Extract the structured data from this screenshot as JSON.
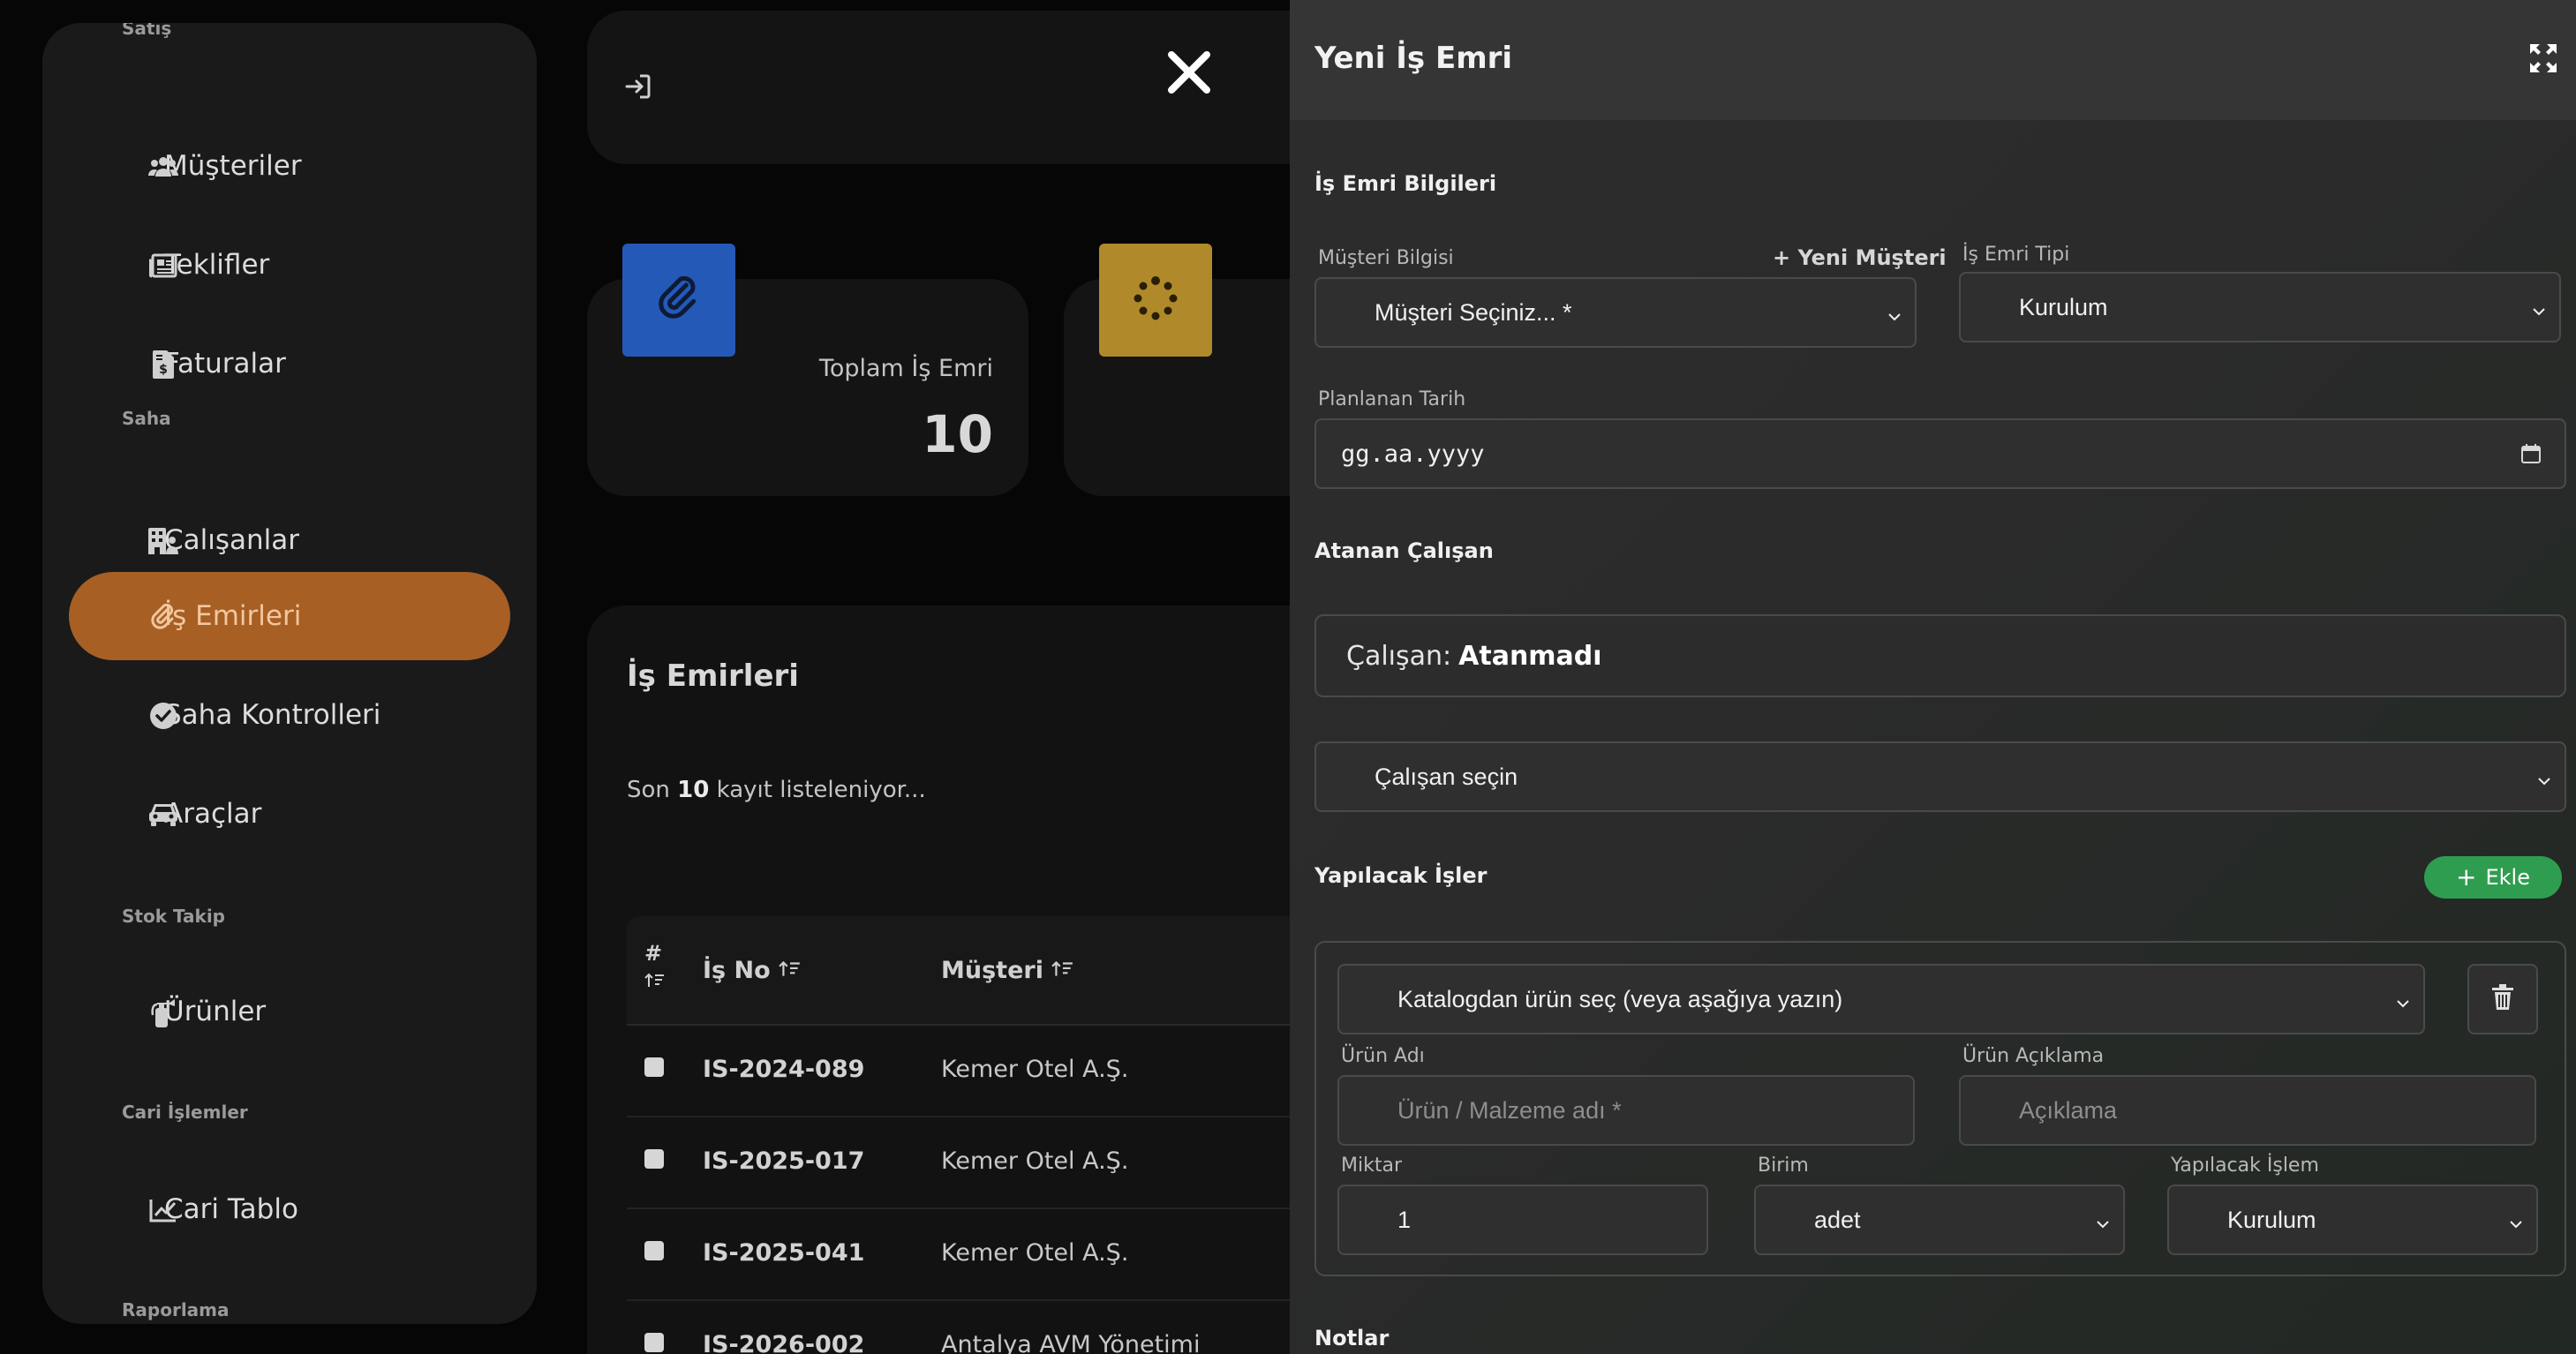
{
  "sidebar": {
    "top_label": "Satış",
    "items": [
      {
        "label": "Müşteriler",
        "icon": "users-icon"
      },
      {
        "label": "Teklifler",
        "icon": "newspaper-icon"
      },
      {
        "label": "Faturalar",
        "icon": "invoice-icon"
      },
      {
        "section": "Saha"
      },
      {
        "label": "Çalışanlar",
        "icon": "building-icon"
      },
      {
        "label": "İş Emirleri",
        "icon": "paperclip-icon",
        "active": true
      },
      {
        "label": "Saha Kontrolleri",
        "icon": "check-circle-icon"
      },
      {
        "label": "Araçlar",
        "icon": "car-icon"
      },
      {
        "section": "Stok Takip"
      },
      {
        "label": "Ürünler",
        "icon": "fire-extinguisher-icon"
      },
      {
        "section": "Cari İşlemler"
      },
      {
        "label": "Cari Tablo",
        "icon": "chart-line-icon"
      },
      {
        "section": "Raporlama"
      }
    ]
  },
  "main": {
    "stat": {
      "label": "Toplam İş Emri",
      "value": "10"
    },
    "list": {
      "title": "İş Emirleri",
      "subtitle_prefix": "Son",
      "subtitle_count": "10",
      "subtitle_suffix": "kayıt listeleniyor...",
      "columns": {
        "index": "#",
        "no": "İş No",
        "customer": "Müşteri"
      },
      "rows": [
        {
          "no": "IS-2024-089",
          "customer": "Kemer Otel A.Ş."
        },
        {
          "no": "IS-2025-017",
          "customer": "Kemer Otel A.Ş."
        },
        {
          "no": "IS-2025-041",
          "customer": "Kemer Otel A.Ş."
        },
        {
          "no": "IS-2026-002",
          "customer": "Antalya AVM Yönetimi"
        }
      ]
    }
  },
  "drawer": {
    "title": "Yeni İş Emri",
    "info_section": "İş Emri Bilgileri",
    "customer_label": "Müşteri Bilgisi",
    "new_customer": "+ Yeni Müşteri",
    "customer_select": "Müşteri Seçiniz... *",
    "type_label": "İş Emri Tipi",
    "type_value": "Kurulum",
    "date_label": "Planlanan Tarih",
    "date_value": "gg.aa.yyyy",
    "assigned_section": "Atanan Çalışan",
    "assigned_prefix": "Çalışan:",
    "assigned_value": "Atanmadı",
    "employee_select": "Çalışan seçin",
    "tasks_section": "Yapılacak İşler",
    "add_label": "Ekle",
    "catalog_select": "Katalogdan ürün seç (veya aşağıya yazın)",
    "product_name_label": "Ürün Adı",
    "product_name_placeholder": "Ürün / Malzeme adı *",
    "product_desc_label": "Ürün Açıklama",
    "product_desc_placeholder": "Açıklama",
    "qty_label": "Miktar",
    "qty_value": "1",
    "unit_label": "Birim",
    "unit_value": "adet",
    "operation_label": "Yapılacak İşlem",
    "operation_value": "Kurulum",
    "notes_section": "Notlar"
  },
  "colors": {
    "accent": "#a85f24",
    "blue_tile": "#2559b8",
    "yellow_tile": "#b08a2a",
    "green_button": "#2f9d4f"
  }
}
